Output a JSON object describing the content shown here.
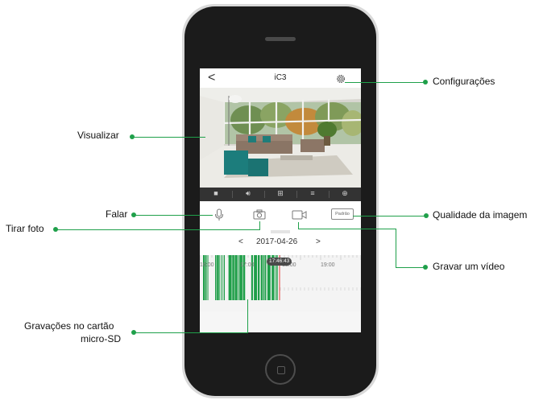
{
  "app": {
    "title": "iC3",
    "back_glyph": "<",
    "settings_icon": "gear-icon"
  },
  "video_toolbar": {
    "icons": [
      "stop-icon",
      "volume-icon",
      "grid-icon",
      "split-view-icon",
      "zoom-in-icon"
    ]
  },
  "actions": {
    "mic_icon": "microphone-icon",
    "camera_icon": "camera-icon",
    "record_icon": "video-record-icon",
    "quality_label": "Padrão"
  },
  "date_nav": {
    "prev": "<",
    "date": "2017-04-26",
    "next": ">"
  },
  "timeline": {
    "current_time": "17:46:43",
    "hour_labels": [
      "16:00",
      "17:00",
      "18:00",
      "19:00"
    ],
    "recording_color": "#1e9e48",
    "cursor_color": "#e03a3a"
  },
  "callouts": {
    "configuracoes": "Configurações",
    "visualizar": "Visualizar",
    "falar": "Falar",
    "tirar_foto": "Tirar foto",
    "qualidade": "Qualidade da imagem",
    "gravar": "Gravar um vídeo",
    "gravacoes_line1": "Gravações no cartão",
    "gravacoes_line2": "micro-SD"
  },
  "colors": {
    "accent_green": "#1fa04a",
    "toolbar_bg": "#333333"
  }
}
